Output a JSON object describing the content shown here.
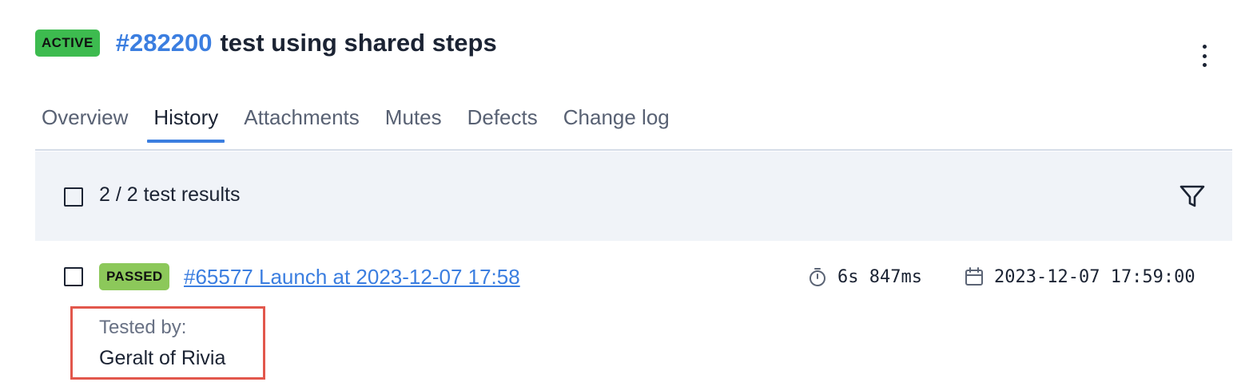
{
  "header": {
    "status": "ACTIVE",
    "test_id": "#282200",
    "test_name": "test using shared steps",
    "more_menu_icon": "kebab-vertical-icon"
  },
  "tabs": [
    {
      "label": "Overview",
      "active": false
    },
    {
      "label": "History",
      "active": true
    },
    {
      "label": "Attachments",
      "active": false
    },
    {
      "label": "Mutes",
      "active": false
    },
    {
      "label": "Defects",
      "active": false
    },
    {
      "label": "Change log",
      "active": false
    }
  ],
  "results_bar": {
    "count_text": "2 / 2 test results",
    "filter_icon": "filter-funnel-icon"
  },
  "results": [
    {
      "status": "PASSED",
      "launch": "#65577 Launch at 2023-12-07 17:58",
      "duration": "6s 847ms",
      "date": "2023-12-07 17:59:00",
      "tested_by_label": "Tested by:",
      "tested_by": "Geralt of Rivia"
    }
  ],
  "colors": {
    "accent": "#3b7ee0",
    "active_badge": "#3dbb4f",
    "passed_badge": "#8cc85a",
    "highlight_border": "#e2574c",
    "toolbar_bg": "#f0f3f8"
  }
}
